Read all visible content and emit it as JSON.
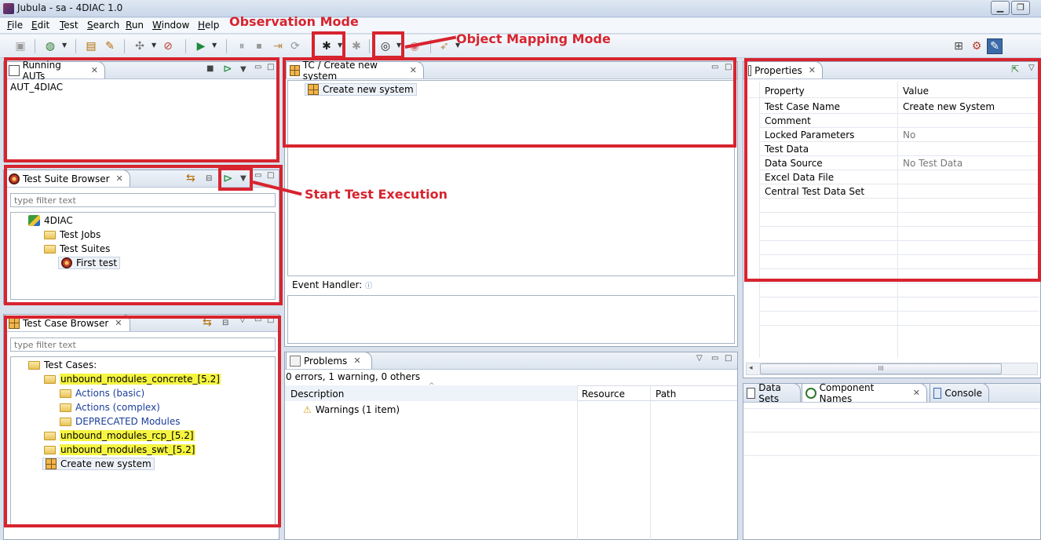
{
  "window": {
    "title": "Jubula - sa - 4DIAC 1.0"
  },
  "menu": [
    "File",
    "Edit",
    "Test",
    "Search",
    "Run",
    "Window",
    "Help"
  ],
  "annotations": {
    "observation_mode": "Observation Mode",
    "object_mapping_mode": "Object Mapping Mode",
    "start_test_execution": "Start Test Execution"
  },
  "running_auts": {
    "title": "Running AUTs",
    "items": [
      "AUT_4DIAC"
    ]
  },
  "test_suite_browser": {
    "title": "Test Suite Browser",
    "filter_placeholder": "type filter text",
    "project": "4DIAC",
    "test_jobs": "Test Jobs",
    "test_suites": "Test Suites",
    "first_test": "First test"
  },
  "test_case_browser": {
    "title": "Test Case Browser",
    "filter_placeholder": "type filter text",
    "root": "Test Cases:",
    "concrete": "unbound_modules_concrete_[5.2]",
    "actions_basic": "Actions (basic)",
    "actions_complex": "Actions (complex)",
    "deprecated": "DEPRECATED Modules",
    "rcp": "unbound_modules_rcp_[5.2]",
    "swt": "unbound_modules_swt_[5.2]",
    "create_new_system": "Create new system"
  },
  "editor": {
    "tab": "TC / Create new system",
    "node": "Create new system",
    "event_handler": "Event Handler:"
  },
  "properties": {
    "title": "Properties",
    "col_property": "Property",
    "col_value": "Value",
    "rows": [
      {
        "property": "Test Case Name",
        "value": "Create new System"
      },
      {
        "property": "Comment",
        "value": ""
      },
      {
        "property": "Locked Parameters",
        "value": "No"
      },
      {
        "property": "Test Data",
        "value": ""
      },
      {
        "property": "Data Source",
        "value": "No Test Data"
      },
      {
        "property": "Excel Data File",
        "value": ""
      },
      {
        "property": "Central Test Data Set",
        "value": ""
      }
    ]
  },
  "problems": {
    "title": "Problems",
    "summary": "0 errors, 1 warning, 0 others",
    "col_description": "Description",
    "col_resource": "Resource",
    "col_path": "Path",
    "warnings": "Warnings (1 item)"
  },
  "bottom_right_tabs": {
    "data_sets": "Data Sets",
    "component_names": "Component Names",
    "console": "Console"
  },
  "scrollbar_thumb": "III"
}
